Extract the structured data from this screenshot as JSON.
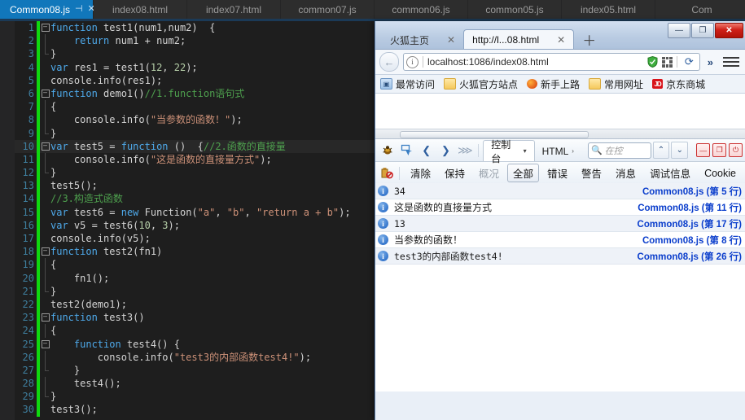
{
  "editor": {
    "tabs": [
      {
        "label": "Common08.js",
        "active": true,
        "pin": "⊣",
        "close": "✕"
      },
      {
        "label": "index08.html",
        "active": false
      },
      {
        "label": "index07.html",
        "active": false
      },
      {
        "label": "common07.js",
        "active": false
      },
      {
        "label": "common06.js",
        "active": false
      },
      {
        "label": "common05.js",
        "active": false
      },
      {
        "label": "index05.html",
        "active": false
      },
      {
        "label": "Com",
        "active": false
      }
    ],
    "lines": [
      {
        "n": "1",
        "fold": "minus",
        "guide": "none",
        "current": false,
        "tokens": [
          {
            "t": "function ",
            "c": "kw"
          },
          {
            "t": "test1",
            "c": "fn"
          },
          {
            "t": "(num1,num2)  {",
            "c": "pl"
          }
        ]
      },
      {
        "n": "2",
        "fold": "bar",
        "guide": "bar",
        "current": false,
        "tokens": [
          {
            "t": "    ",
            "c": "pl"
          },
          {
            "t": "return",
            "c": "kw"
          },
          {
            "t": " num1 + num2;",
            "c": "pl"
          }
        ]
      },
      {
        "n": "3",
        "fold": "end",
        "guide": "end",
        "current": false,
        "tokens": [
          {
            "t": "}",
            "c": "pl"
          }
        ]
      },
      {
        "n": "4",
        "fold": "none",
        "guide": "none",
        "current": false,
        "tokens": [
          {
            "t": "var",
            "c": "kw"
          },
          {
            "t": " res1 = test1(",
            "c": "pl"
          },
          {
            "t": "12",
            "c": "num"
          },
          {
            "t": ", ",
            "c": "pl"
          },
          {
            "t": "22",
            "c": "num"
          },
          {
            "t": ");",
            "c": "pl"
          }
        ]
      },
      {
        "n": "5",
        "fold": "none",
        "guide": "none",
        "current": false,
        "tokens": [
          {
            "t": "console.info(res1);",
            "c": "pl"
          }
        ]
      },
      {
        "n": "6",
        "fold": "minus",
        "guide": "none",
        "current": false,
        "tokens": [
          {
            "t": "function ",
            "c": "kw"
          },
          {
            "t": "demo1",
            "c": "fn"
          },
          {
            "t": "()",
            "c": "pl"
          },
          {
            "t": "//1.function语句式",
            "c": "cmt"
          }
        ]
      },
      {
        "n": "7",
        "fold": "bar",
        "guide": "bar",
        "current": false,
        "tokens": [
          {
            "t": "{",
            "c": "pl"
          }
        ]
      },
      {
        "n": "8",
        "fold": "bar",
        "guide": "bar",
        "current": false,
        "tokens": [
          {
            "t": "    console.info(",
            "c": "pl"
          },
          {
            "t": "\"当参数的函数！\"",
            "c": "str"
          },
          {
            "t": ");",
            "c": "pl"
          }
        ]
      },
      {
        "n": "9",
        "fold": "end",
        "guide": "end",
        "current": false,
        "tokens": [
          {
            "t": "}",
            "c": "pl"
          }
        ]
      },
      {
        "n": "10",
        "fold": "minus",
        "guide": "none",
        "current": true,
        "tokens": [
          {
            "t": "var",
            "c": "kw"
          },
          {
            "t": " test5 = ",
            "c": "pl"
          },
          {
            "t": "function",
            "c": "kw"
          },
          {
            "t": " ()  {",
            "c": "pl"
          },
          {
            "t": "//2.函数的直接量",
            "c": "cmt"
          }
        ]
      },
      {
        "n": "11",
        "fold": "bar",
        "guide": "bar",
        "current": false,
        "tokens": [
          {
            "t": "    console.info(",
            "c": "pl"
          },
          {
            "t": "\"这是函数的直接量方式\"",
            "c": "str"
          },
          {
            "t": ");",
            "c": "pl"
          }
        ]
      },
      {
        "n": "12",
        "fold": "end",
        "guide": "end",
        "current": false,
        "tokens": [
          {
            "t": "}",
            "c": "pl"
          }
        ]
      },
      {
        "n": "13",
        "fold": "none",
        "guide": "none",
        "current": false,
        "tokens": [
          {
            "t": "test5();",
            "c": "pl"
          }
        ]
      },
      {
        "n": "14",
        "fold": "none",
        "guide": "none",
        "current": false,
        "tokens": [
          {
            "t": "//3.构造式函数",
            "c": "cmt"
          }
        ]
      },
      {
        "n": "15",
        "fold": "none",
        "guide": "none",
        "current": false,
        "tokens": [
          {
            "t": "var",
            "c": "kw"
          },
          {
            "t": " test6 = ",
            "c": "pl"
          },
          {
            "t": "new",
            "c": "kw"
          },
          {
            "t": " Function(",
            "c": "pl"
          },
          {
            "t": "\"a\"",
            "c": "str"
          },
          {
            "t": ", ",
            "c": "pl"
          },
          {
            "t": "\"b\"",
            "c": "str"
          },
          {
            "t": ", ",
            "c": "pl"
          },
          {
            "t": "\"return a + b\"",
            "c": "str"
          },
          {
            "t": ");",
            "c": "pl"
          }
        ]
      },
      {
        "n": "16",
        "fold": "none",
        "guide": "none",
        "current": false,
        "tokens": [
          {
            "t": "var",
            "c": "kw"
          },
          {
            "t": " v5 = test6(",
            "c": "pl"
          },
          {
            "t": "10",
            "c": "num"
          },
          {
            "t": ", ",
            "c": "pl"
          },
          {
            "t": "3",
            "c": "num"
          },
          {
            "t": ");",
            "c": "pl"
          }
        ]
      },
      {
        "n": "17",
        "fold": "none",
        "guide": "none",
        "current": false,
        "tokens": [
          {
            "t": "console.info(v5);",
            "c": "pl"
          }
        ]
      },
      {
        "n": "18",
        "fold": "minus",
        "guide": "none",
        "current": false,
        "tokens": [
          {
            "t": "function ",
            "c": "kw"
          },
          {
            "t": "test2",
            "c": "fn"
          },
          {
            "t": "(fn1)",
            "c": "pl"
          }
        ]
      },
      {
        "n": "19",
        "fold": "bar",
        "guide": "bar",
        "current": false,
        "tokens": [
          {
            "t": "{",
            "c": "pl"
          }
        ]
      },
      {
        "n": "20",
        "fold": "bar",
        "guide": "bar",
        "current": false,
        "tokens": [
          {
            "t": "    fn1();",
            "c": "pl"
          }
        ]
      },
      {
        "n": "21",
        "fold": "end",
        "guide": "end",
        "current": false,
        "tokens": [
          {
            "t": "}",
            "c": "pl"
          }
        ]
      },
      {
        "n": "22",
        "fold": "none",
        "guide": "none",
        "current": false,
        "tokens": [
          {
            "t": "test2(demo1);",
            "c": "pl"
          }
        ]
      },
      {
        "n": "23",
        "fold": "minus",
        "guide": "none",
        "current": false,
        "tokens": [
          {
            "t": "function ",
            "c": "kw"
          },
          {
            "t": "test3",
            "c": "fn"
          },
          {
            "t": "()",
            "c": "pl"
          }
        ]
      },
      {
        "n": "24",
        "fold": "bar",
        "guide": "bar",
        "current": false,
        "tokens": [
          {
            "t": "{",
            "c": "pl"
          }
        ]
      },
      {
        "n": "25",
        "fold": "minus2",
        "guide": "bar",
        "current": false,
        "tokens": [
          {
            "t": "    ",
            "c": "pl"
          },
          {
            "t": "function",
            "c": "kw"
          },
          {
            "t": " test4() {",
            "c": "pl"
          }
        ]
      },
      {
        "n": "26",
        "fold": "bar2",
        "guide": "bar",
        "current": false,
        "tokens": [
          {
            "t": "        console.info(",
            "c": "pl"
          },
          {
            "t": "\"test3的内部函数test4!\"",
            "c": "str"
          },
          {
            "t": ");",
            "c": "pl"
          }
        ]
      },
      {
        "n": "27",
        "fold": "end2",
        "guide": "bar",
        "current": false,
        "tokens": [
          {
            "t": "    }",
            "c": "pl"
          }
        ]
      },
      {
        "n": "28",
        "fold": "bar",
        "guide": "bar",
        "current": false,
        "tokens": [
          {
            "t": "    test4();",
            "c": "pl"
          }
        ]
      },
      {
        "n": "29",
        "fold": "end",
        "guide": "end",
        "current": false,
        "tokens": [
          {
            "t": "}",
            "c": "pl"
          }
        ]
      },
      {
        "n": "30",
        "fold": "none",
        "guide": "none",
        "current": false,
        "tokens": [
          {
            "t": "test3();",
            "c": "pl"
          }
        ]
      }
    ]
  },
  "firefox": {
    "window_buttons": {
      "minimize": "—",
      "maximize": "❐",
      "close": "✕"
    },
    "tabs": [
      {
        "label": "火狐主页",
        "close": "✕",
        "active": false
      },
      {
        "label": "http://l...08.html",
        "close": "✕",
        "active": true
      }
    ],
    "new_tab_label": "＋",
    "nav": {
      "back_icon": "←",
      "info_icon": "i",
      "url": "localhost:1086/index08.html",
      "reload_icon": "⟳",
      "overflow_icon": "»",
      "menu_icon": "hamburger"
    },
    "bookmarks": [
      {
        "label": "最常访问",
        "icon": "mostvis"
      },
      {
        "label": "火狐官方站点",
        "icon": "folder"
      },
      {
        "label": "新手上路",
        "icon": "fox"
      },
      {
        "label": "常用网址",
        "icon": "folder"
      },
      {
        "label": "京东商城",
        "icon": "jd",
        "badge": "JD"
      }
    ]
  },
  "devtools": {
    "toolbar": {
      "bug_icon": "🐞",
      "picker_icon": "⌖",
      "back_icon": "❮",
      "forward_icon": "❯",
      "list_icon": "⋙",
      "tabs": [
        {
          "label": "控制台",
          "caret": "▾",
          "active": true
        },
        {
          "label": "HTML",
          "caret": "›",
          "active": false
        }
      ],
      "search_placeholder": "在控",
      "search_icon": "search-icon",
      "up_icon": "⌃",
      "down_icon": "⌄",
      "dock_min": "—",
      "dock_window": "❐",
      "dock_close": "⏻"
    },
    "filters": {
      "clear_log_icon": "clear-log-icon",
      "buttons": [
        {
          "label": "清除",
          "state": "normal"
        },
        {
          "label": "保持",
          "state": "normal"
        },
        {
          "label": "概况",
          "state": "dim"
        },
        {
          "label": "全部",
          "state": "selected"
        },
        {
          "label": "错误",
          "state": "normal"
        },
        {
          "label": "警告",
          "state": "normal"
        },
        {
          "label": "消息",
          "state": "normal"
        },
        {
          "label": "调试信息",
          "state": "normal"
        },
        {
          "label": "Cookie",
          "state": "normal"
        }
      ]
    },
    "log": [
      {
        "level": "i",
        "message": "34",
        "source": "Common08.js (第 5 行)",
        "cjk": false
      },
      {
        "level": "i",
        "message": "这是函数的直接量方式",
        "source": "Common08.js (第 11 行)",
        "cjk": true
      },
      {
        "level": "i",
        "message": "13",
        "source": "Common08.js (第 17 行)",
        "cjk": false
      },
      {
        "level": "i",
        "message": "当参数的函数！",
        "source": "Common08.js (第 8 行)",
        "cjk": true
      },
      {
        "level": "i",
        "message": "test3的内部函数test4!",
        "source": "Common08.js (第 26 行)",
        "cjk": false
      }
    ]
  },
  "colors": {
    "editor_bg": "#1e1e1e",
    "tab_active": "#1177bb",
    "change_bar": "#0fd80f",
    "comment": "#4ea04e",
    "string": "#cd9178",
    "keyword": "#4ea9ea",
    "log_source": "#0b3ecc",
    "close_button": "#cf2018"
  }
}
